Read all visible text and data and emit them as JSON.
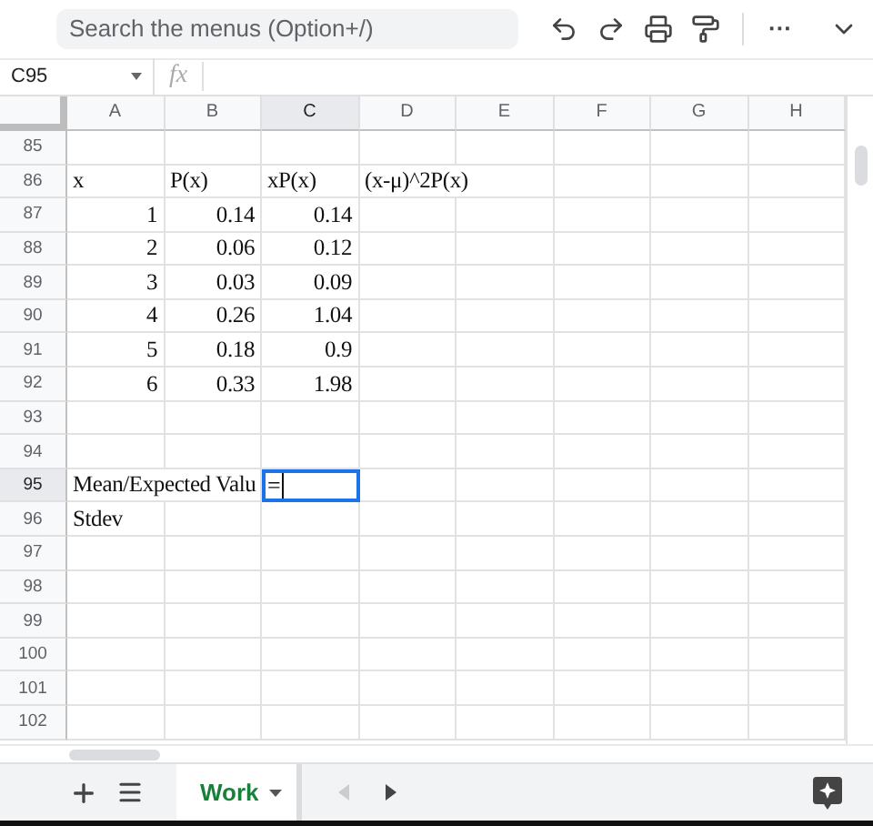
{
  "toolbar": {
    "search": {
      "placeholder": "Search the menus (Option+/)"
    },
    "more": "···"
  },
  "formula_bar": {
    "name_box": "C95",
    "fx": "fx"
  },
  "columns": [
    {
      "label": "A",
      "selected": false
    },
    {
      "label": "B",
      "selected": false
    },
    {
      "label": "C",
      "selected": true
    },
    {
      "label": "D",
      "selected": false
    },
    {
      "label": "E",
      "selected": false
    },
    {
      "label": "F",
      "selected": false
    },
    {
      "label": "G",
      "selected": false
    },
    {
      "label": "H",
      "selected": false
    }
  ],
  "rows": [
    {
      "number": "85",
      "selected": false
    },
    {
      "number": "86",
      "selected": false,
      "cells": [
        {
          "kind": "text",
          "text": "x"
        },
        {
          "kind": "text",
          "text": "P(x)"
        },
        {
          "kind": "text",
          "text": "xP(x)"
        },
        {
          "kind": "text",
          "text": "(x-μ)^2P(x)"
        },
        {
          "kind": "blank"
        }
      ]
    },
    {
      "number": "87",
      "selected": false,
      "cells": [
        {
          "kind": "number",
          "text": "1"
        },
        {
          "kind": "number",
          "text": "0.14"
        },
        {
          "kind": "number",
          "text": "0.14"
        }
      ]
    },
    {
      "number": "88",
      "selected": false,
      "cells": [
        {
          "kind": "number",
          "text": "2"
        },
        {
          "kind": "number",
          "text": "0.06"
        },
        {
          "kind": "number",
          "text": "0.12"
        }
      ]
    },
    {
      "number": "89",
      "selected": false,
      "cells": [
        {
          "kind": "number",
          "text": "3"
        },
        {
          "kind": "number",
          "text": "0.03"
        },
        {
          "kind": "number",
          "text": "0.09"
        }
      ]
    },
    {
      "number": "90",
      "selected": false,
      "cells": [
        {
          "kind": "number",
          "text": "4"
        },
        {
          "kind": "number",
          "text": "0.26"
        },
        {
          "kind": "number",
          "text": "1.04"
        }
      ]
    },
    {
      "number": "91",
      "selected": false,
      "cells": [
        {
          "kind": "number",
          "text": "5"
        },
        {
          "kind": "number",
          "text": "0.18"
        },
        {
          "kind": "number",
          "text": "0.9"
        }
      ]
    },
    {
      "number": "92",
      "selected": false,
      "cells": [
        {
          "kind": "number",
          "text": "6"
        },
        {
          "kind": "number",
          "text": "0.33"
        },
        {
          "kind": "number",
          "text": "1.98"
        }
      ]
    },
    {
      "number": "93",
      "selected": false
    },
    {
      "number": "94",
      "selected": false
    },
    {
      "number": "95",
      "selected": true,
      "cells": [
        {
          "kind": "text",
          "text": "Mean/Expected Valu"
        },
        {
          "kind": "blank"
        },
        {
          "kind": "editing",
          "text": "="
        }
      ]
    },
    {
      "number": "96",
      "selected": false,
      "cells": [
        {
          "kind": "text",
          "text": "Stdev"
        }
      ]
    },
    {
      "number": "97",
      "selected": false
    },
    {
      "number": "98",
      "selected": false
    },
    {
      "number": "99",
      "selected": false
    },
    {
      "number": "100",
      "selected": false
    },
    {
      "number": "101",
      "selected": false
    },
    {
      "number": "102",
      "selected": false
    }
  ],
  "sheet_tabs": [
    {
      "label": "Work",
      "selected": true
    }
  ]
}
